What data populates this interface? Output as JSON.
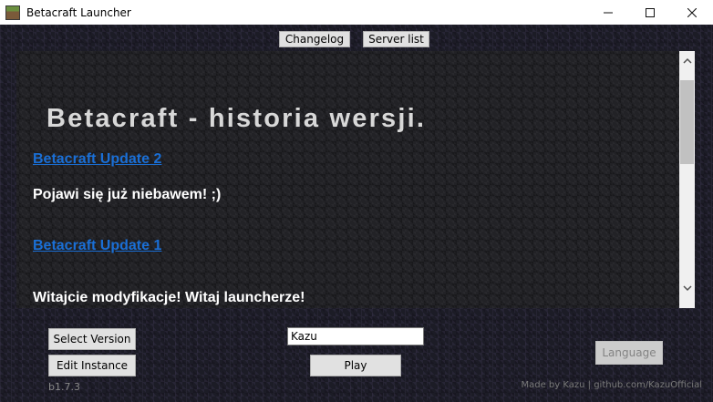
{
  "window": {
    "title": "Betacraft Launcher",
    "minimize_glyph": "—",
    "maximize_glyph": "☐",
    "close_glyph": "✕"
  },
  "tabs": {
    "changelog_label": "Changelog",
    "server_list_label": "Server list"
  },
  "changelog": {
    "heading": "Betacraft - historia wersji.",
    "entries": [
      {
        "title": "Betacraft Update 2",
        "text": "Pojawi się już niebawem! ;)"
      },
      {
        "title": "Betacraft Update 1",
        "text": "Witajcie modyfikacje! Witaj launcherze!"
      }
    ]
  },
  "controls": {
    "select_version_label": "Select Version",
    "edit_instance_label": "Edit Instance",
    "username_value": "Kazu",
    "play_label": "Play",
    "language_label": "Language"
  },
  "footer": {
    "version": "b1.7.3",
    "credit": "Made by Kazu | github.com/KazuOfficial"
  },
  "colors": {
    "link": "#1a6fd6",
    "heading": "#d8d8d8",
    "panel_bg": "#222226"
  }
}
